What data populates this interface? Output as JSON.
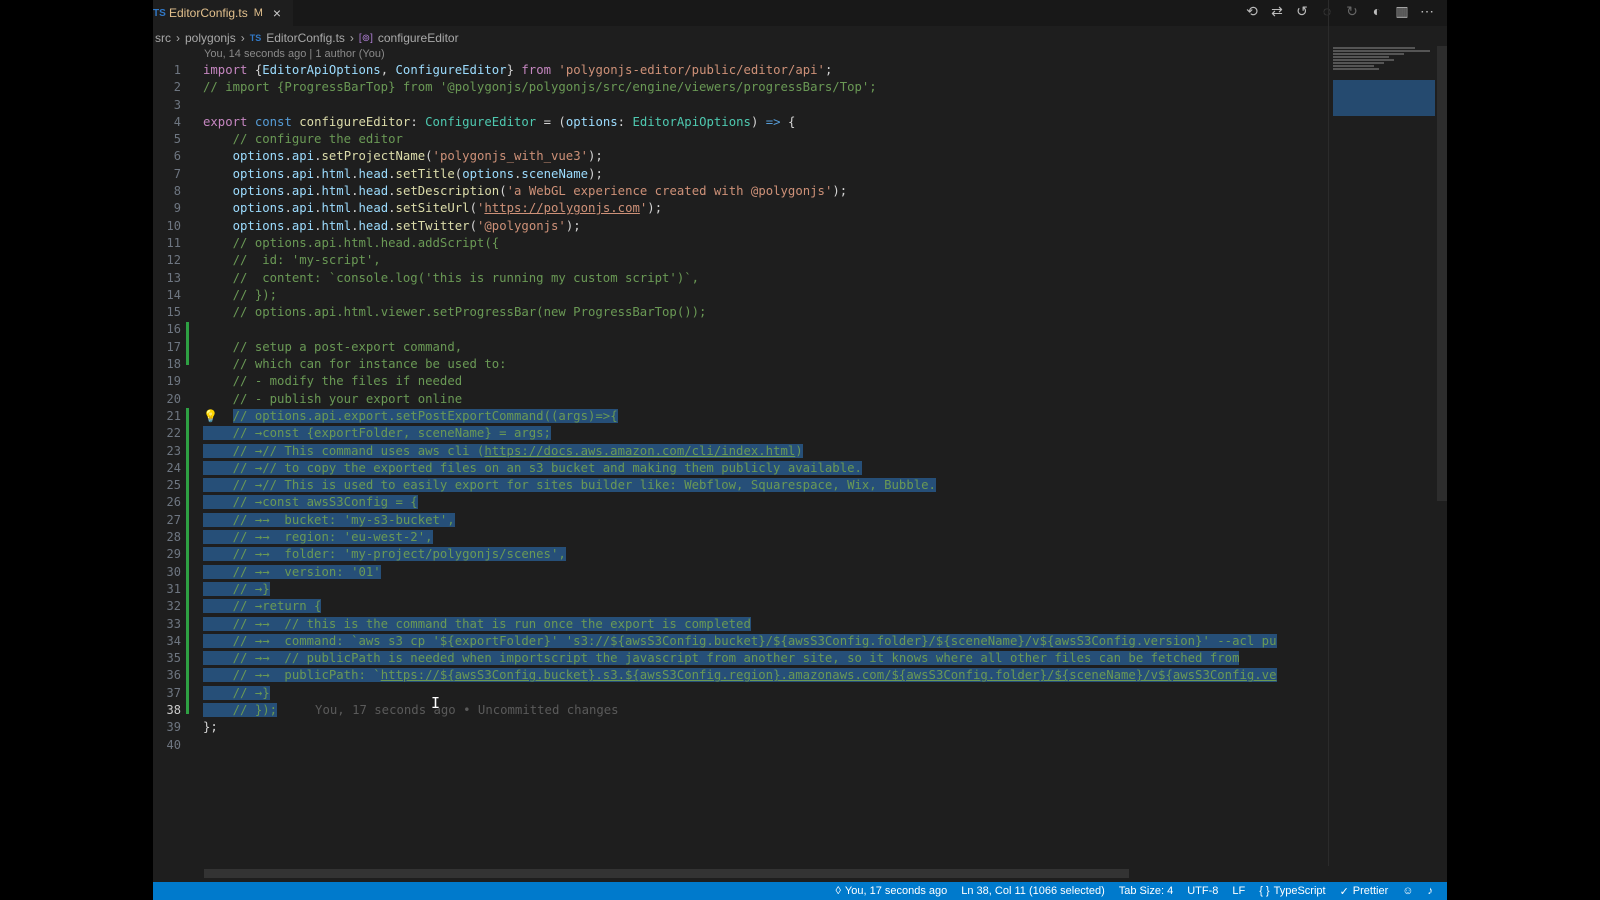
{
  "tab": {
    "lang": "TS",
    "name": "EditorConfig.ts",
    "modified": "M",
    "close": "×"
  },
  "breadcrumb": {
    "src": "src",
    "folder": "polygonjs",
    "lang": "TS",
    "file": "EditorConfig.ts",
    "fn_icon": "[⊚]",
    "fn": "configureEditor"
  },
  "blame": "You, 14 seconds ago | 1 author (You)",
  "ghost": "You, 17 seconds ago • Uncommitted changes",
  "statusbar": {
    "git": "You, 17 seconds ago",
    "position": "Ln 38, Col 11 (1066 selected)",
    "tab_size": "Tab Size: 4",
    "encoding": "UTF-8",
    "eol": "LF",
    "language": "TypeScript",
    "formatter": "Prettier"
  },
  "icons": [
    "history-icon",
    "compare-icon",
    "revert-icon",
    "back-icon",
    "forward-icon",
    "split-icon",
    "more-icon"
  ],
  "colors": {
    "statusbar": "#007acc",
    "selection": "#264f78",
    "comment": "#6a9955",
    "string": "#ce9178"
  }
}
